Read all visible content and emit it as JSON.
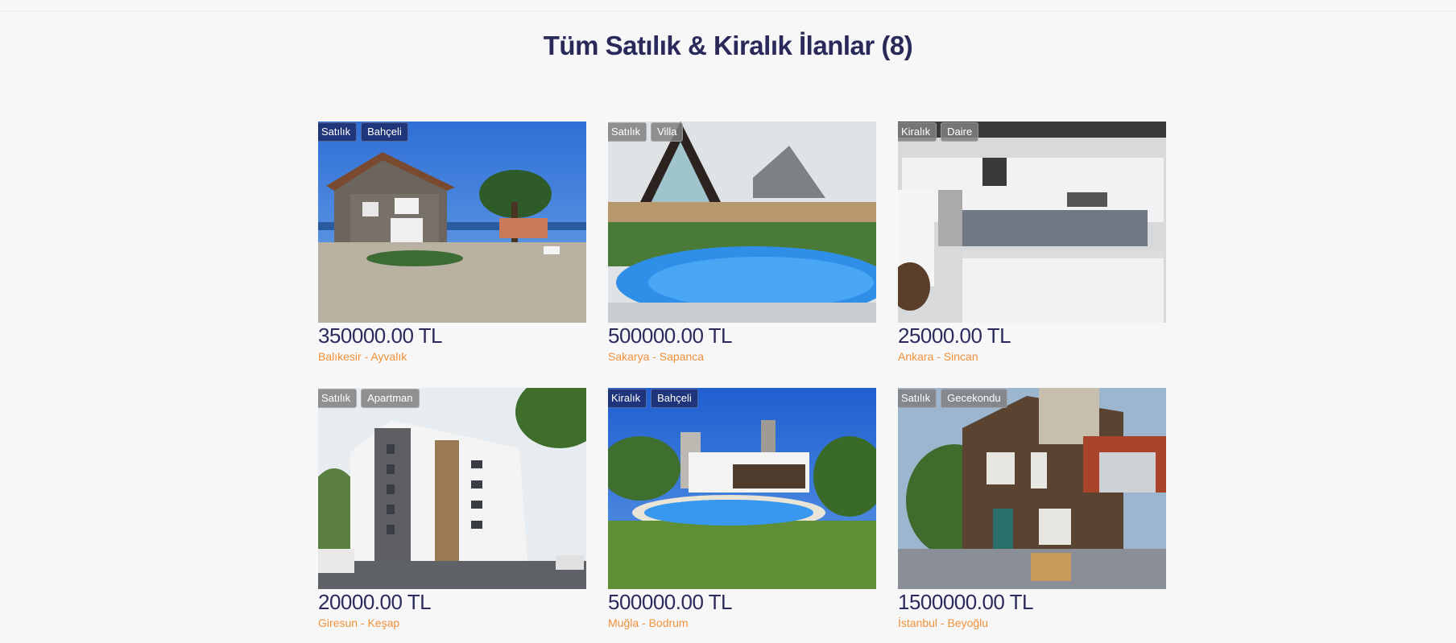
{
  "page": {
    "title": "Tüm Satılık & Kiralık İlanlar (8)"
  },
  "listings": [
    {
      "price": "350000.00 TL",
      "location": "Balıkesir - Ayvalık",
      "badges": [
        {
          "label": "Satılık",
          "style": "navy"
        },
        {
          "label": "Bahçeli",
          "style": "navy"
        }
      ],
      "photo_icon": "stone-house-photo"
    },
    {
      "price": "500000.00 TL",
      "location": "Sakarya - Sapanca",
      "badges": [
        {
          "label": "Satılık",
          "style": "gray"
        },
        {
          "label": "Villa",
          "style": "gray"
        }
      ],
      "photo_icon": "a-frame-villa-pool-photo"
    },
    {
      "price": "25000.00 TL",
      "location": "Ankara - Sincan",
      "badges": [
        {
          "label": "Kiralık",
          "style": "gray"
        },
        {
          "label": "Daire",
          "style": "gray"
        }
      ],
      "photo_icon": "kitchen-photo"
    },
    {
      "price": "20000.00 TL",
      "location": "Giresun - Keşap",
      "badges": [
        {
          "label": "Satılık",
          "style": "gray"
        },
        {
          "label": "Apartman",
          "style": "gray"
        }
      ],
      "photo_icon": "apartment-building-photo"
    },
    {
      "price": "500000.00 TL",
      "location": "Muğla - Bodrum",
      "badges": [
        {
          "label": "Kiralık",
          "style": "navy"
        },
        {
          "label": "Bahçeli",
          "style": "navy"
        }
      ],
      "photo_icon": "modern-villa-pool-photo"
    },
    {
      "price": "1500000.00 TL",
      "location": "İstanbul - Beyoğlu",
      "badges": [
        {
          "label": "Satılık",
          "style": "gray"
        },
        {
          "label": "Gecekondu",
          "style": "gray"
        }
      ],
      "photo_icon": "old-wooden-house-photo"
    }
  ]
}
